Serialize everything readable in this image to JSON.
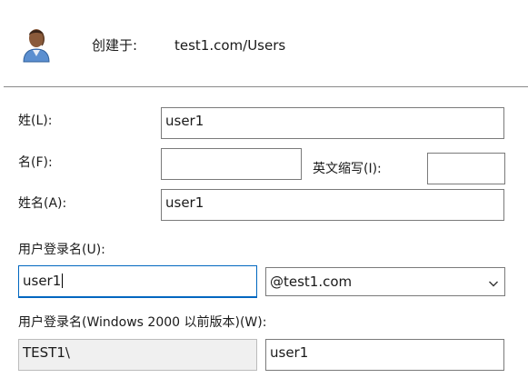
{
  "header": {
    "created_in_label": "创建于:",
    "created_in_value": "test1.com/Users"
  },
  "form": {
    "last_name_label": "姓(L):",
    "last_name_value": "user1",
    "first_name_label": "名(F):",
    "first_name_value": "",
    "initials_label": "英文缩写(I):",
    "initials_value": "",
    "full_name_label": "姓名(A):",
    "full_name_value": "user1",
    "logon_name_label": "用户登录名(U):",
    "logon_name_value": "user1",
    "domain_selected": "@test1.com",
    "pre2000_label": "用户登录名(Windows 2000 以前版本)(W):",
    "pre2000_domain_value": "TEST1\\",
    "pre2000_name_value": "user1"
  },
  "icons": {
    "user": "user-icon",
    "dropdown": "chevron-down-icon"
  }
}
